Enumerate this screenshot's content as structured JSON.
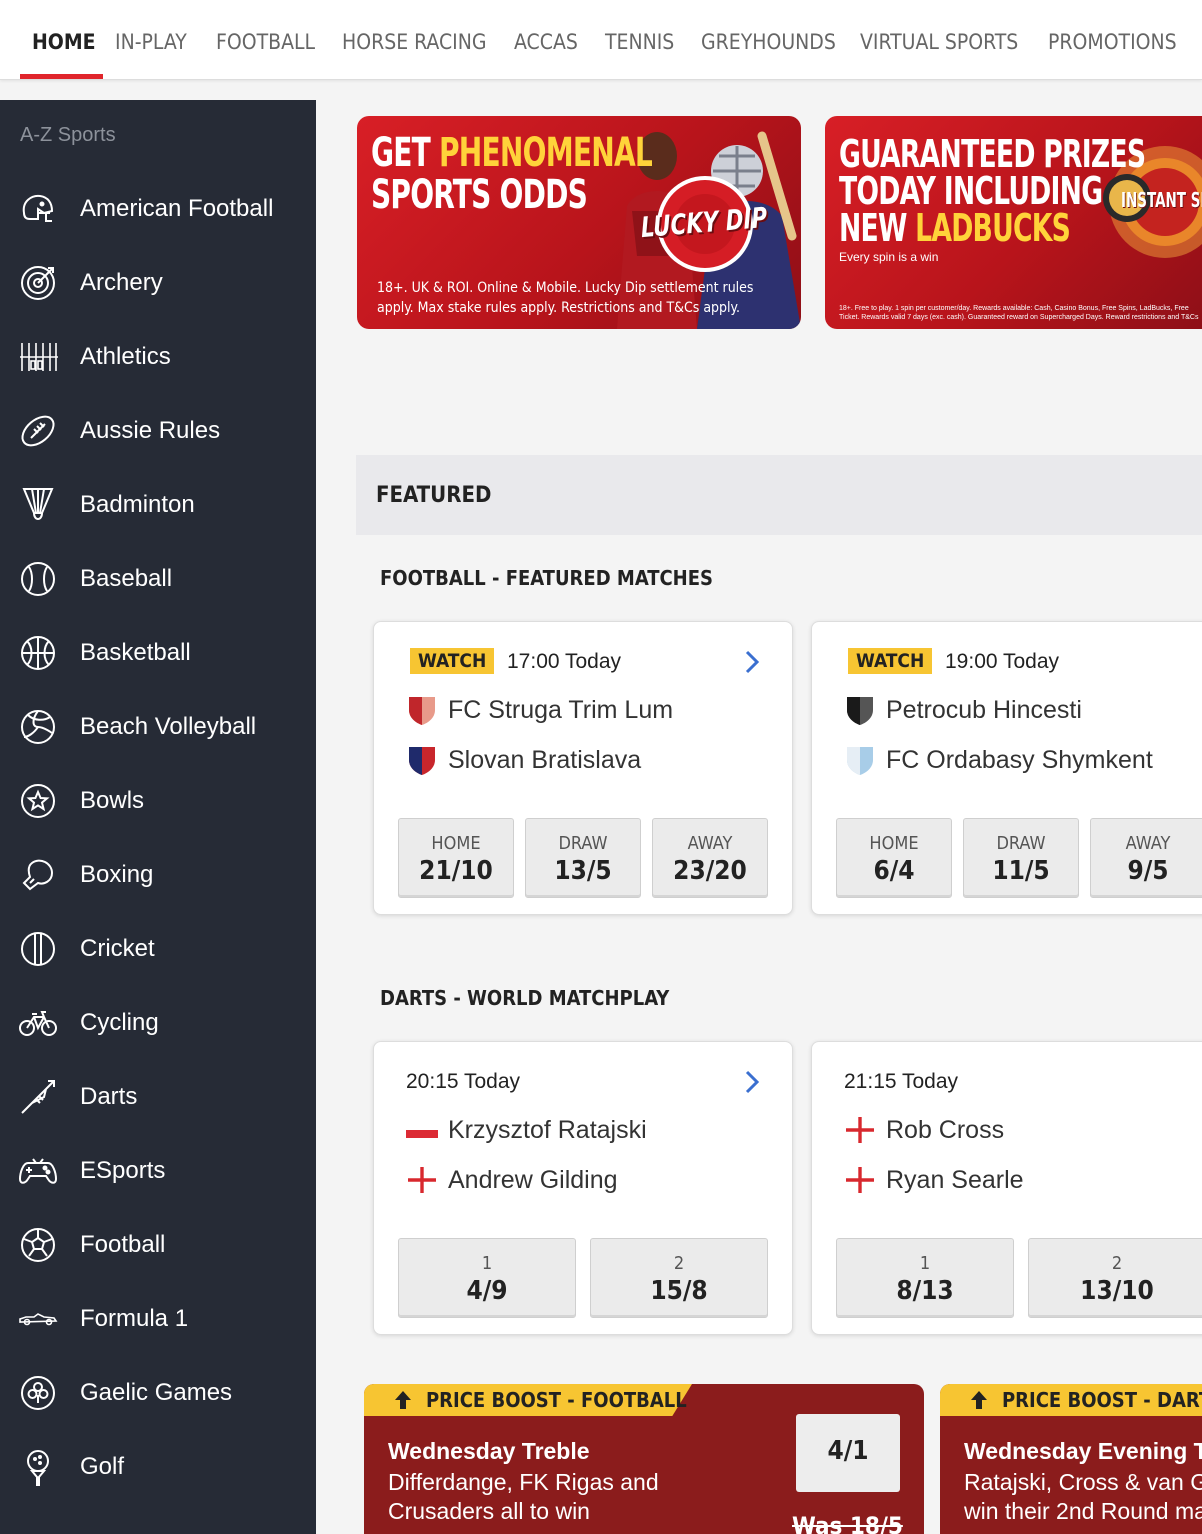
{
  "nav": {
    "tabs": [
      {
        "label": "HOME",
        "active": true
      },
      {
        "label": "IN-PLAY"
      },
      {
        "label": "FOOTBALL"
      },
      {
        "label": "HORSE RACING"
      },
      {
        "label": "ACCAS"
      },
      {
        "label": "TENNIS"
      },
      {
        "label": "GREYHOUNDS"
      },
      {
        "label": "VIRTUAL SPORTS"
      },
      {
        "label": "PROMOTIONS"
      }
    ]
  },
  "sidebar": {
    "heading": "A-Z Sports",
    "items": [
      {
        "label": "American Football",
        "icon": "american-football-helmet-icon"
      },
      {
        "label": "Archery",
        "icon": "archery-target-icon"
      },
      {
        "label": "Athletics",
        "icon": "athletics-track-icon"
      },
      {
        "label": "Aussie Rules",
        "icon": "aussie-rules-ball-icon"
      },
      {
        "label": "Badminton",
        "icon": "shuttlecock-icon"
      },
      {
        "label": "Baseball",
        "icon": "baseball-icon"
      },
      {
        "label": "Basketball",
        "icon": "basketball-icon"
      },
      {
        "label": "Beach Volleyball",
        "icon": "volleyball-icon"
      },
      {
        "label": "Bowls",
        "icon": "bowls-icon"
      },
      {
        "label": "Boxing",
        "icon": "boxing-glove-icon"
      },
      {
        "label": "Cricket",
        "icon": "cricket-ball-icon"
      },
      {
        "label": "Cycling",
        "icon": "bicycle-icon"
      },
      {
        "label": "Darts",
        "icon": "dart-icon"
      },
      {
        "label": "ESports",
        "icon": "gamepad-icon"
      },
      {
        "label": "Football",
        "icon": "football-icon"
      },
      {
        "label": "Formula 1",
        "icon": "f1-car-icon"
      },
      {
        "label": "Gaelic Games",
        "icon": "shamrock-ball-icon"
      },
      {
        "label": "Golf",
        "icon": "golf-ball-tee-icon"
      }
    ]
  },
  "banners": [
    {
      "headline_1a": "GET ",
      "headline_1b": "PHENOMENAL",
      "headline_2": "SPORTS ODDS",
      "badge": "LUCKY DIP",
      "terms": "18+. UK & ROI. Online & Mobile. Lucky Dip settlement rules apply. Max stake rules apply. Restrictions and T&Cs apply."
    },
    {
      "headline_1": "GUARANTEED PRIZES",
      "headline_2": "TODAY INCLUDING",
      "headline_3a": "NEW ",
      "headline_3b": "LADBUCKS",
      "sub": "Every spin is a win",
      "badge": "INSTANT SP",
      "terms": "18+. Free to play. 1 spin per customer/day. Rewards available: Cash, Casino Bonus, Free Spins, LadBucks, Free Ticket. Rewards valid 7 days (exc. cash). Guaranteed reward on Supercharged Days. Reward restrictions and T&Cs"
    }
  ],
  "featured": {
    "title": "FEATURED",
    "football": {
      "title": "FOOTBALL - FEATURED MATCHES",
      "matches": [
        {
          "watch": "WATCH",
          "time": "17:00 Today",
          "home": "FC Struga Trim Lum",
          "away": "Slovan Bratislava",
          "home_colors": [
            "#c0262b",
            "#e89a8a"
          ],
          "away_colors": [
            "#1f2a6b",
            "#c8262c"
          ],
          "odds": [
            {
              "label": "HOME",
              "value": "21/10"
            },
            {
              "label": "DRAW",
              "value": "13/5"
            },
            {
              "label": "AWAY",
              "value": "23/20"
            }
          ]
        },
        {
          "watch": "WATCH",
          "time": "19:00 Today",
          "home": "Petrocub Hincesti",
          "away": "FC Ordabasy Shymkent",
          "home_colors": [
            "#1a1a1a",
            "#555555"
          ],
          "away_colors": [
            "#a8cde8",
            "#e6eef5"
          ],
          "odds": [
            {
              "label": "HOME",
              "value": "6/4"
            },
            {
              "label": "DRAW",
              "value": "11/5"
            },
            {
              "label": "AWAY",
              "value": "9/5"
            }
          ]
        }
      ]
    },
    "darts": {
      "title": "DARTS - WORLD MATCHPLAY",
      "matches": [
        {
          "time": "20:15 Today",
          "player1": "Krzysztof Ratajski",
          "player2": "Andrew Gilding",
          "flag1": "poland-flag-icon",
          "flag2": "england-flag-icon",
          "odds": [
            {
              "label": "1",
              "value": "4/9"
            },
            {
              "label": "2",
              "value": "15/8"
            }
          ]
        },
        {
          "time": "21:15 Today",
          "player1": "Rob Cross",
          "player2": "Ryan Searle",
          "flag1": "england-flag-icon",
          "flag2": "england-flag-icon",
          "odds": [
            {
              "label": "1",
              "value": "8/13"
            },
            {
              "label": "2",
              "value": "13/10"
            }
          ]
        }
      ]
    }
  },
  "boosts": [
    {
      "tag": "PRICE BOOST - FOOTBALL",
      "title": "Wednesday Treble",
      "desc": "Differdange, FK Rigas and Crusaders all to win",
      "odds": "4/1",
      "was": "Was 18/5"
    },
    {
      "tag": "PRICE BOOST - DARTS",
      "title": "Wednesday Evening T",
      "desc": "Ratajski, Cross & van G win their 2nd Round ma"
    }
  ],
  "colors": {
    "accent_red": "#e0252b",
    "sidebar_bg": "#262b36",
    "watch_yellow": "#f7c532",
    "boost_bg": "#8b1c1c",
    "chevron_blue": "#3a6fd0"
  }
}
